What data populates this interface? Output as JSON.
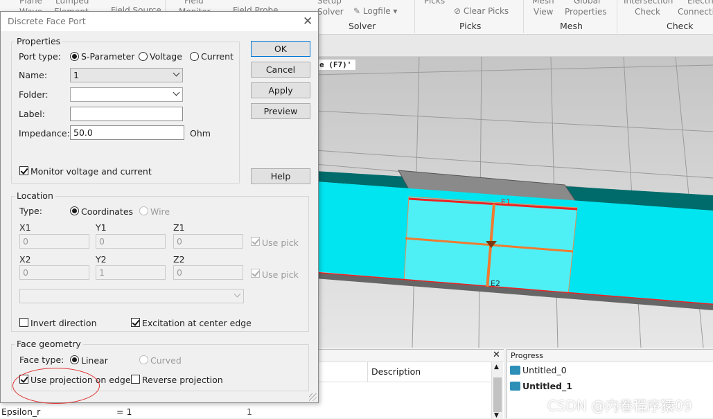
{
  "ribbon": {
    "partial_labels": [
      "Plane",
      "Lumped",
      "Field Source",
      "Field",
      "Field Probe",
      "Setup",
      "Logfile",
      "Picks",
      "Clear Picks",
      "Mesh",
      "Global",
      "Intersection",
      "Electric"
    ],
    "mid_labels": [
      "Wave",
      "Element",
      "Monitor",
      "Solver",
      "View",
      "Properties",
      "Check",
      "Connectivity"
    ],
    "groups": {
      "solver": "Solver",
      "picks": "Picks",
      "mesh": "Mesh",
      "check": "Check"
    }
  },
  "viewport": {
    "hint": "e (F7)'",
    "edge_labels": [
      "E1",
      "E2"
    ],
    "colors": {
      "substrate": "#00e5f0",
      "port_edge": "#ee2222",
      "port_line": "#f07a30",
      "ground": "#006b6b"
    }
  },
  "params_panel": {
    "description_header": "Description",
    "row": {
      "name": "Epsilon_r",
      "expression": "= 1",
      "value": "1"
    }
  },
  "progress_panel": {
    "title": "Progress",
    "items": [
      "Untitled_0",
      "Untitled_1"
    ]
  },
  "dialog": {
    "title": "Discrete Face Port",
    "properties": {
      "title": "Properties",
      "port_type_label": "Port type:",
      "port_type_options": [
        "S-Parameter",
        "Voltage",
        "Current"
      ],
      "port_type_selected": "S-Parameter",
      "name_label": "Name:",
      "name_value": "1",
      "folder_label": "Folder:",
      "folder_value": "",
      "label_label": "Label:",
      "label_value": "",
      "impedance_label": "Impedance:",
      "impedance_value": "50.0",
      "impedance_unit": "Ohm",
      "monitor_label": "Monitor voltage and current",
      "monitor_checked": true
    },
    "buttons": {
      "ok": "OK",
      "cancel": "Cancel",
      "apply": "Apply",
      "preview": "Preview",
      "help": "Help"
    },
    "location": {
      "title": "Location",
      "type_label": "Type:",
      "type_options": [
        "Coordinates",
        "Wire"
      ],
      "type_selected": "Coordinates",
      "x1_label": "X1",
      "y1_label": "Y1",
      "z1_label": "Z1",
      "x1": "0",
      "y1": "0",
      "z1": "0",
      "x2_label": "X2",
      "y2_label": "Y2",
      "z2_label": "Z2",
      "x2": "0",
      "y2": "1",
      "z2": "0",
      "use_pick_label": "Use pick",
      "invert_label": "Invert direction",
      "invert_checked": false,
      "center_edge_label": "Excitation at center edge",
      "center_edge_checked": true
    },
    "face_geometry": {
      "title": "Face geometry",
      "face_type_label": "Face type:",
      "face_type_options": [
        "Linear",
        "Curved"
      ],
      "face_type_selected": "Linear",
      "projection_label": "Use projection on edge",
      "projection_checked": true,
      "reverse_label": "Reverse projection",
      "reverse_checked": false
    }
  },
  "watermark": "CSDN @内卷程序猿09"
}
